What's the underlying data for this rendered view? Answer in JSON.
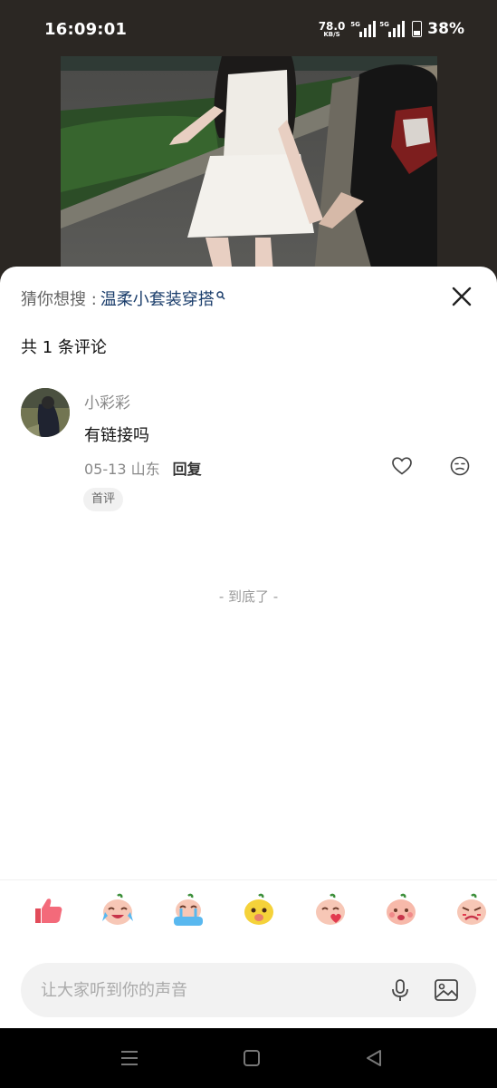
{
  "status_bar": {
    "time": "16:09:01",
    "net_speed": "78.0",
    "net_unit": "KB/S",
    "signal1_tag": "5G",
    "signal2_tag": "5G",
    "battery": "38%"
  },
  "sheet": {
    "guess_label": "猜你想搜 : ",
    "guess_query": "温柔小套装穿搭",
    "comment_count": "共 1 条评论",
    "end_text": "- 到底了 -"
  },
  "comments": [
    {
      "user": "小彩彩",
      "text": "有链接吗",
      "date_location": "05-13 山东",
      "reply_label": "回复",
      "badge": "首评"
    }
  ],
  "emoji_bar": {
    "items": [
      "thumbs-up-emoji",
      "laugh-cry-emoji",
      "crying-emoji",
      "dog-face-emoji",
      "heart-emoji",
      "peach-shy-emoji",
      "angry-emoji"
    ]
  },
  "input": {
    "placeholder": "让大家听到你的声音",
    "value": ""
  },
  "colors": {
    "sheet_bg": "#ffffff",
    "query_blue": "#1a3d6b",
    "status_bg": "#2b2723"
  }
}
